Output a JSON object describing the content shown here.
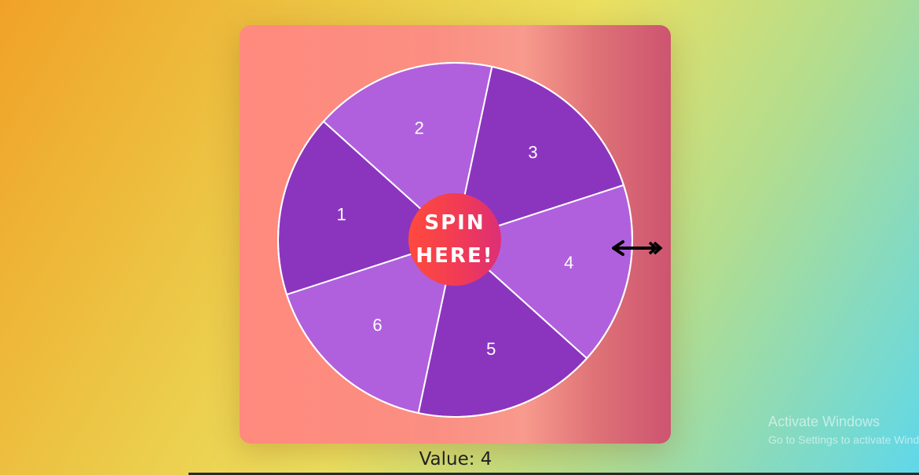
{
  "wheel": {
    "segments": [
      {
        "label": "1",
        "color": "#8b35bf"
      },
      {
        "label": "2",
        "color": "#b060dd"
      },
      {
        "label": "3",
        "color": "#8b35bf"
      },
      {
        "label": "4",
        "color": "#b060dd"
      },
      {
        "label": "5",
        "color": "#8b35bf"
      },
      {
        "label": "6",
        "color": "#b060dd"
      }
    ],
    "border_color": "#ffffff"
  },
  "spin_button": {
    "line1": "SPIN",
    "line2": "HERE!"
  },
  "pointer": {
    "icon": "arrow-left-icon",
    "color": "#000000"
  },
  "result": {
    "text": "Value: 4"
  },
  "watermark": {
    "title": "Activate Windows",
    "subtitle": "Go to Settings to activate Windows."
  }
}
